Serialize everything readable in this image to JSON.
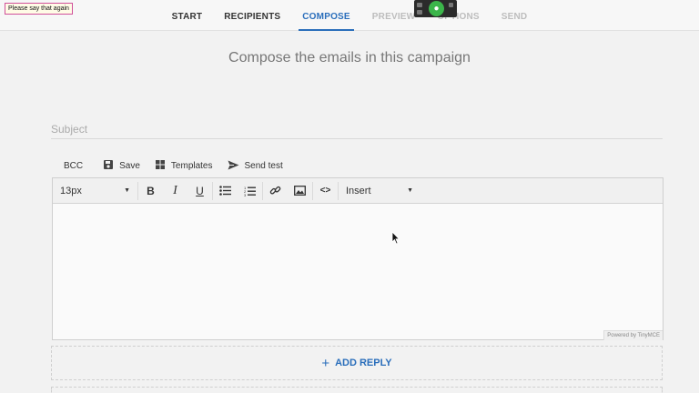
{
  "toast": {
    "text": "Please say that again"
  },
  "nav": {
    "steps": [
      {
        "label": "START",
        "state": "done"
      },
      {
        "label": "RECIPIENTS",
        "state": "done"
      },
      {
        "label": "COMPOSE",
        "state": "active"
      },
      {
        "label": "PREVIEW",
        "state": "disabled"
      },
      {
        "label": "OPTIONS",
        "state": "disabled"
      },
      {
        "label": "SEND",
        "state": "disabled"
      }
    ]
  },
  "main": {
    "heading": "Compose the emails in this campaign",
    "subject_placeholder": "Subject",
    "subject_value": ""
  },
  "actions": {
    "bcc": "BCC",
    "save": "Save",
    "templates": "Templates",
    "send_test": "Send test"
  },
  "editor": {
    "font_size": "13px",
    "insert_label": "Insert",
    "body": "",
    "powered_by": "Powered by TinyMCE"
  },
  "add_reply": {
    "label": "ADD REPLY"
  },
  "colors": {
    "accent": "#2a6ebb",
    "mic": "#3bb54a"
  },
  "icons": [
    "save-icon",
    "templates-icon",
    "send-icon",
    "bold-icon",
    "italic-icon",
    "underline-icon",
    "bullet-list-icon",
    "numbered-list-icon",
    "link-icon",
    "image-icon",
    "code-icon",
    "plus-icon",
    "microphone-icon",
    "mouse-cursor-icon"
  ]
}
